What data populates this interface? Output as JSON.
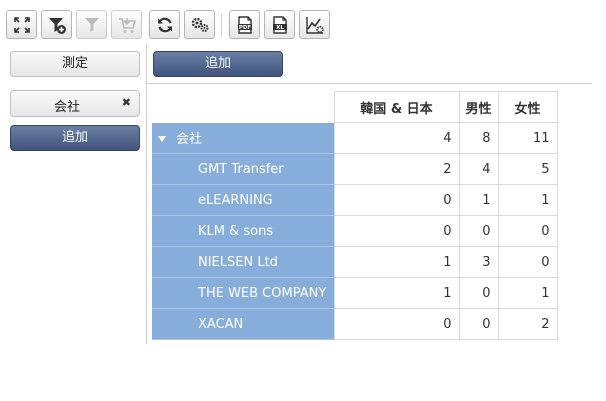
{
  "toolbar": {
    "buttons": [
      {
        "icon": "expand-icon",
        "enabled": true
      },
      {
        "icon": "add-filter-icon",
        "enabled": true
      },
      {
        "icon": "filter-icon",
        "enabled": false
      },
      {
        "icon": "cart-export-icon",
        "enabled": false
      },
      {
        "icon": "refresh-icon",
        "enabled": true
      },
      {
        "icon": "settings-icon",
        "enabled": true
      },
      {
        "icon": "export-pdf-icon",
        "enabled": true
      },
      {
        "icon": "export-excel-icon",
        "enabled": true
      },
      {
        "icon": "chart-settings-icon",
        "enabled": true
      }
    ]
  },
  "left_panel": {
    "measure_label": "測定",
    "dimension_chip": "会社",
    "chip_remove_glyph": "✖",
    "add_row_label": "追加"
  },
  "column_area": {
    "add_column_label": "追加"
  },
  "pivot": {
    "columns": [
      "韓国 & 日本",
      "男性",
      "女性"
    ],
    "rows": [
      {
        "label": "会社",
        "group": true,
        "values": [
          "4",
          "8",
          "11"
        ]
      },
      {
        "label": "GMT Transfer",
        "group": false,
        "values": [
          "2",
          "4",
          "5"
        ]
      },
      {
        "label": "eLEARNING",
        "group": false,
        "values": [
          "0",
          "1",
          "1"
        ]
      },
      {
        "label": "KLM & sons",
        "group": false,
        "values": [
          "0",
          "0",
          "0"
        ]
      },
      {
        "label": "NIELSEN Ltd",
        "group": false,
        "values": [
          "1",
          "3",
          "0"
        ]
      },
      {
        "label": "THE WEB COMPANY",
        "group": false,
        "values": [
          "1",
          "0",
          "1"
        ]
      },
      {
        "label": "XACAN",
        "group": false,
        "values": [
          "0",
          "0",
          "2"
        ]
      }
    ]
  },
  "colors": {
    "row_header_bg": "#87aedb",
    "primary_button": "#40547d"
  }
}
